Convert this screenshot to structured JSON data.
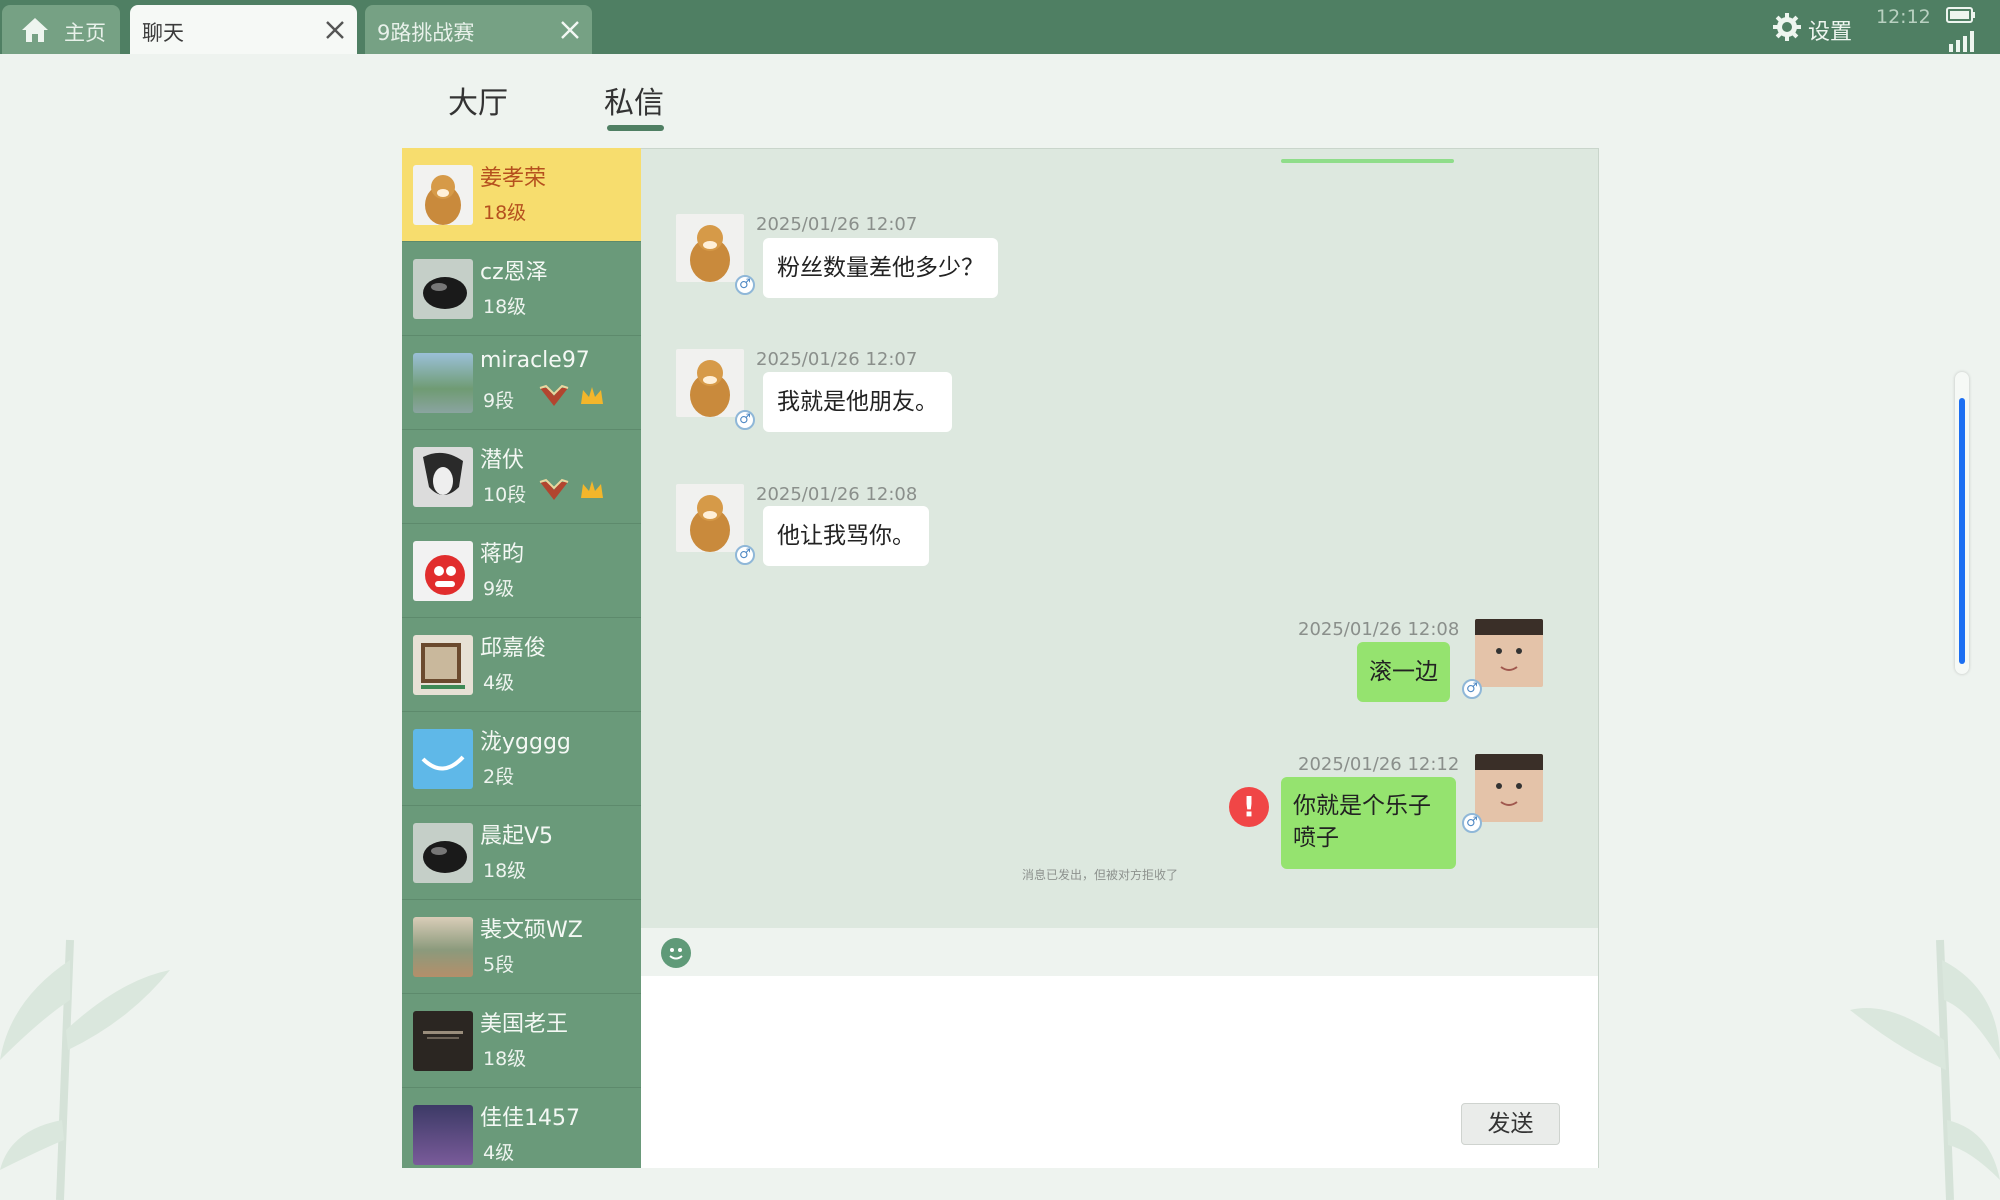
{
  "top_tabs": {
    "home": "主页",
    "chat": "聊天",
    "game": "9路挑战赛"
  },
  "status": {
    "settings_label": "设置",
    "time": "12:12"
  },
  "content_tabs": {
    "hall": "大厅",
    "dm": "私信",
    "selected": "私信"
  },
  "contacts": [
    {
      "name": "姜孝荣",
      "rank": "18级",
      "active": true
    },
    {
      "name": "cz恩泽",
      "rank": "18级"
    },
    {
      "name": "miracle97",
      "rank": "9段",
      "badges": [
        "vip-badge-icon",
        "crown-icon"
      ]
    },
    {
      "name": "潜伏",
      "rank": "10段",
      "badges": [
        "vip-badge-icon",
        "crown-icon"
      ]
    },
    {
      "name": "蒋昀",
      "rank": "9级"
    },
    {
      "name": "邱嘉俊",
      "rank": "4级"
    },
    {
      "name": "泷ygggg",
      "rank": "2段"
    },
    {
      "name": "晨起V5",
      "rank": "18级"
    },
    {
      "name": "裴文硕WZ",
      "rank": "5段"
    },
    {
      "name": "美国老王",
      "rank": "18级"
    },
    {
      "name": "佳佳1457",
      "rank": "4级"
    }
  ],
  "messages": [
    {
      "side": "in",
      "time": "2025/01/26 12:07",
      "text": "粉丝数量差他多少？"
    },
    {
      "side": "in",
      "time": "2025/01/26 12:07",
      "text": "我就是他朋友。"
    },
    {
      "side": "in",
      "time": "2025/01/26 12:08",
      "text": "他让我骂你。"
    },
    {
      "side": "out",
      "time": "2025/01/26 12:08",
      "text": "滚一边"
    },
    {
      "side": "out",
      "time": "2025/01/26 12:12",
      "text_line1": "你就是个乐子",
      "text_line2": "喷子",
      "failed": true
    }
  ],
  "reject_notice": "消息已发出，但被对方拒收了",
  "gender_symbol": "♂",
  "error_symbol": "!",
  "send_label": "发送",
  "colors": {
    "topbar": "#4f7f63",
    "sidebar": "#6a9a7a",
    "active_contact": "#f7dd6e",
    "outgoing_bubble": "#95e36f",
    "scrollbar": "#1d6ff2",
    "error": "#f04646"
  }
}
